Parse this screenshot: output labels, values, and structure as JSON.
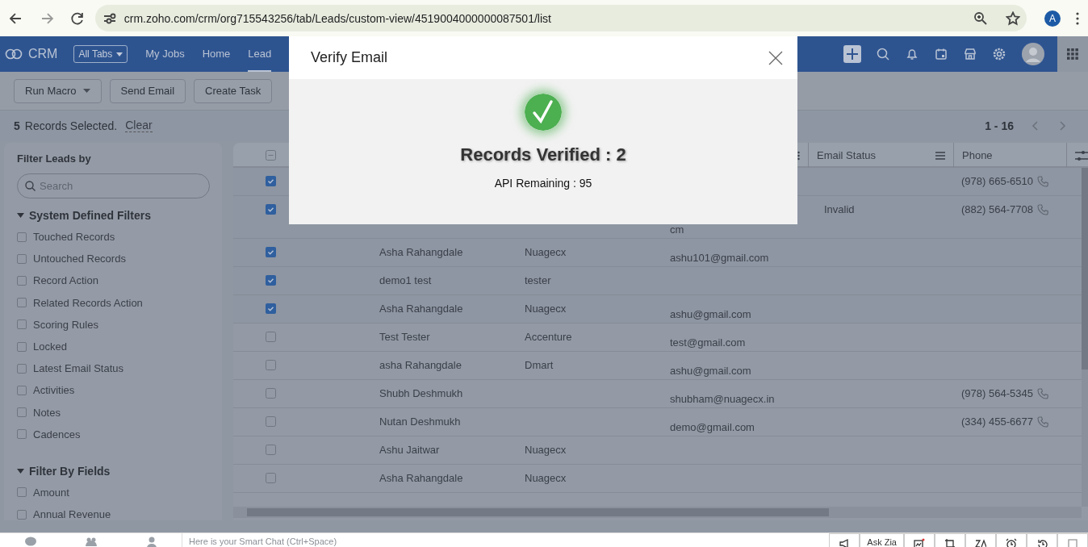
{
  "browser": {
    "url": "crm.zoho.com/crm/org715543256/tab/Leads/custom-view/4519004000000087501/list",
    "profile_initial": "A"
  },
  "nav": {
    "logo": "CRM",
    "all_tabs": "All Tabs",
    "tabs": [
      {
        "label": "My Jobs",
        "selected": false
      },
      {
        "label": "Home",
        "selected": false
      },
      {
        "label": "Lead",
        "selected": true
      }
    ]
  },
  "toolbar": {
    "buttons": [
      {
        "label": "Run Macro",
        "kind": "dropdown"
      },
      {
        "label": "Send Email",
        "kind": "plain"
      },
      {
        "label": "Create Task",
        "kind": "plain"
      }
    ]
  },
  "selection": {
    "count": "5",
    "text": "Records Selected.",
    "clear": "Clear"
  },
  "pagination": {
    "range": "1 - 16"
  },
  "filters": {
    "title": "Filter Leads by",
    "search_placeholder": "Search",
    "groups": [
      {
        "title": "System Defined Filters",
        "expanded": true,
        "items": [
          {
            "label": "Touched Records",
            "checked": false
          },
          {
            "label": "Untouched Records",
            "checked": false
          },
          {
            "label": "Record Action",
            "checked": false
          },
          {
            "label": "Related Records Action",
            "checked": false
          },
          {
            "label": "Scoring Rules",
            "checked": false
          },
          {
            "label": "Locked",
            "checked": false
          },
          {
            "label": "Latest Email Status",
            "checked": false
          },
          {
            "label": "Activities",
            "checked": false
          },
          {
            "label": "Notes",
            "checked": false
          },
          {
            "label": "Cadences",
            "checked": false
          }
        ]
      },
      {
        "title": "Filter By Fields",
        "expanded": true,
        "items": [
          {
            "label": "Amount",
            "checked": false
          },
          {
            "label": "Annual Revenue",
            "checked": false
          }
        ]
      }
    ]
  },
  "table": {
    "select_all": {
      "checked": false,
      "indeterminate": true
    },
    "columns": [
      "Email Status",
      "Phone"
    ],
    "rows": [
      {
        "selected": true,
        "phone": "(978) 665-6510"
      },
      {
        "selected": true,
        "email": "cm",
        "email_status": "Invalid",
        "phone": "(882) 564-7708"
      },
      {
        "selected": true,
        "name": "Asha Rahangdale",
        "company": "Nuagecx",
        "email": "ashu101@gmail.com"
      },
      {
        "selected": true,
        "name": "demo1 test",
        "company": "tester"
      },
      {
        "selected": true,
        "name": "Asha Rahangdale",
        "company": "Nuagecx",
        "email": "ashu@gmail.com"
      },
      {
        "selected": false,
        "name": "Test Tester",
        "company": "Accenture",
        "email": "test@gmail.com"
      },
      {
        "selected": false,
        "name": "asha Rahangdale",
        "company": "Dmart",
        "email": "ashu@gmail.com"
      },
      {
        "selected": false,
        "name": "Shubh Deshmukh",
        "email": "shubham@nuagecx.in",
        "phone": "(978) 564-5345"
      },
      {
        "selected": false,
        "name": "Nutan Deshmukh",
        "email": "demo@gmail.com",
        "phone": "(334) 455-6677"
      },
      {
        "selected": false,
        "name": "Ashu Jaitwar",
        "company": "Nuagecx"
      },
      {
        "selected": false,
        "name": "Asha Rahangdale",
        "company": "Nuagecx"
      }
    ]
  },
  "modal": {
    "title": "Verify Email",
    "heading": "Records Verified : 2",
    "detail": "API Remaining : 95"
  },
  "bottom_bar": {
    "chat_placeholder": "Here is your Smart Chat (Ctrl+Space)",
    "ask_zia": "Ask Zia"
  }
}
